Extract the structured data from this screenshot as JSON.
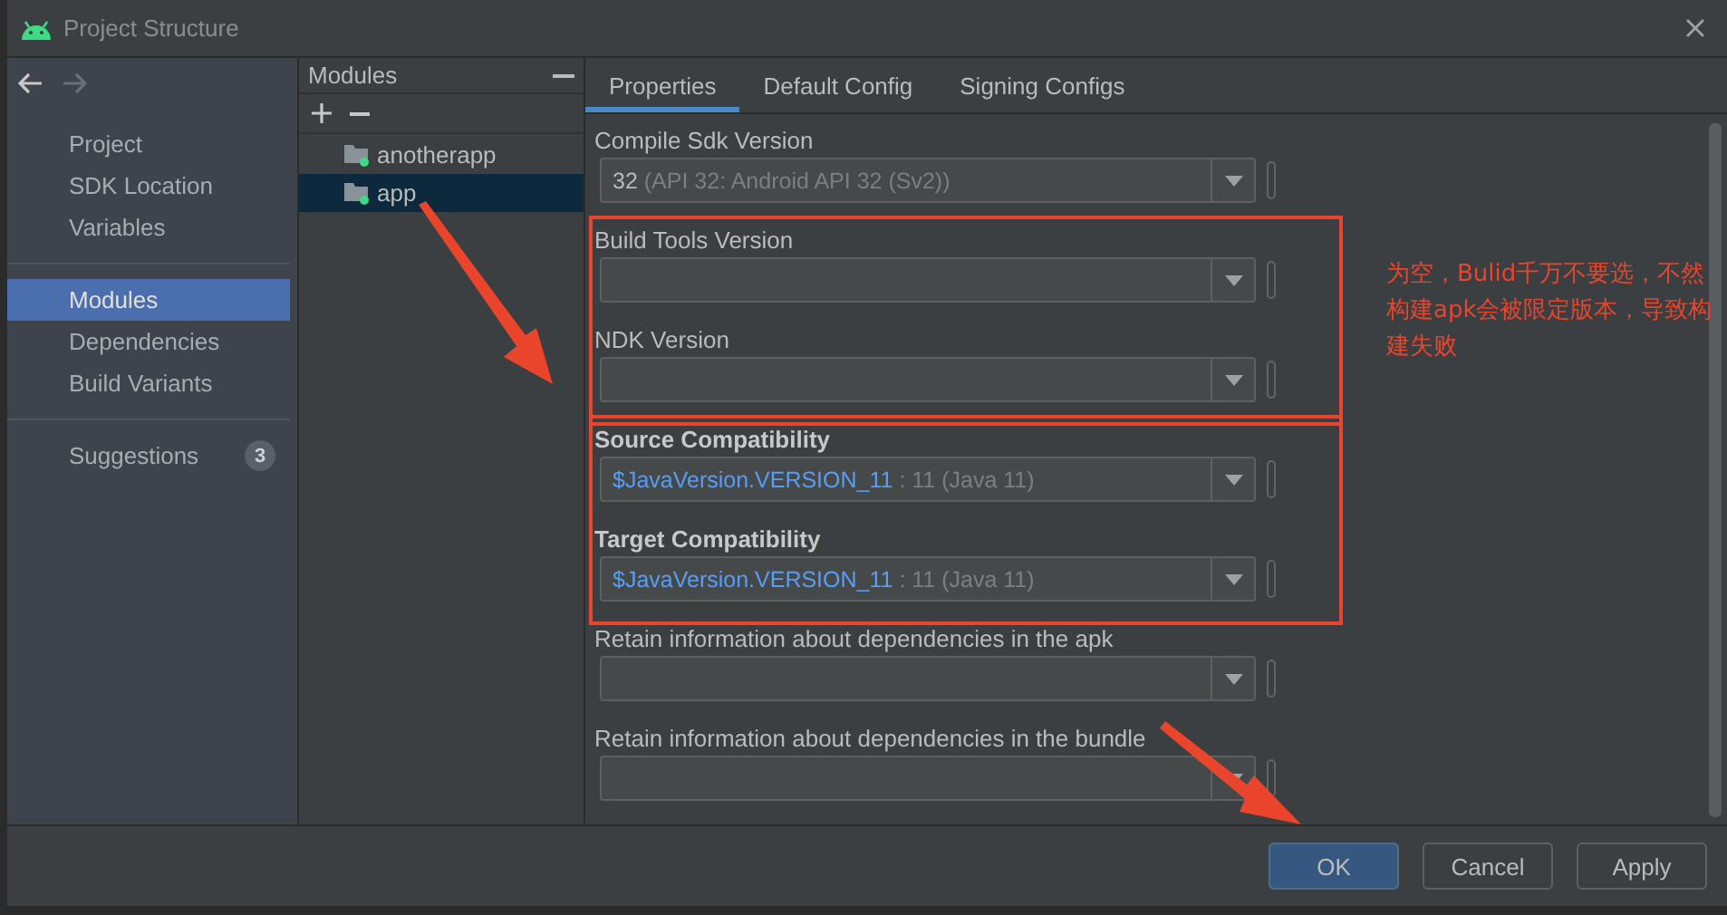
{
  "window": {
    "title": "Project Structure"
  },
  "sidebar": {
    "groups": [
      {
        "items": [
          {
            "label": "Project",
            "selected": false
          },
          {
            "label": "SDK Location",
            "selected": false
          },
          {
            "label": "Variables",
            "selected": false
          }
        ]
      },
      {
        "items": [
          {
            "label": "Modules",
            "selected": true
          },
          {
            "label": "Dependencies",
            "selected": false
          },
          {
            "label": "Build Variants",
            "selected": false
          }
        ]
      },
      {
        "items": [
          {
            "label": "Suggestions",
            "selected": false,
            "badge": "3"
          }
        ]
      }
    ]
  },
  "modules": {
    "title": "Modules",
    "items": [
      {
        "label": "anotherapp",
        "selected": false
      },
      {
        "label": "app",
        "selected": true
      }
    ]
  },
  "tabs": [
    {
      "label": "Properties",
      "selected": true
    },
    {
      "label": "Default Config",
      "selected": false
    },
    {
      "label": "Signing Configs",
      "selected": false
    }
  ],
  "sections": [
    {
      "highlighted": false,
      "fields": [
        {
          "label": "Compile Sdk Version",
          "bold": false,
          "value": "32",
          "kind": "plain",
          "hint": "(API 32: Android API 32 (Sv2))"
        }
      ]
    },
    {
      "highlighted": true,
      "fields": [
        {
          "label": "Build Tools Version",
          "bold": false
        },
        {
          "label": "NDK Version",
          "bold": false
        }
      ]
    },
    {
      "highlighted": true,
      "fields": [
        {
          "label": "Source Compatibility",
          "bold": true,
          "value": "$JavaVersion.VERSION_11",
          "kind": "reference",
          "hint": ": 11 (Java 11)"
        },
        {
          "label": "Target Compatibility",
          "bold": true,
          "value": "$JavaVersion.VERSION_11",
          "kind": "reference",
          "hint": ": 11 (Java 11)"
        }
      ]
    },
    {
      "highlighted": false,
      "fields": [
        {
          "label": "Retain information about dependencies in the apk",
          "bold": false
        },
        {
          "label": "Retain information about dependencies in the bundle",
          "bold": false
        }
      ]
    }
  ],
  "annotation": {
    "note": "为空，Bulid千万不要选，不然构建apk会被限定版本，导致构建失败"
  },
  "buttons": [
    {
      "label": "OK",
      "kind": "primary"
    },
    {
      "label": "Cancel",
      "kind": "normal"
    },
    {
      "label": "Apply",
      "kind": "normal"
    }
  ]
}
